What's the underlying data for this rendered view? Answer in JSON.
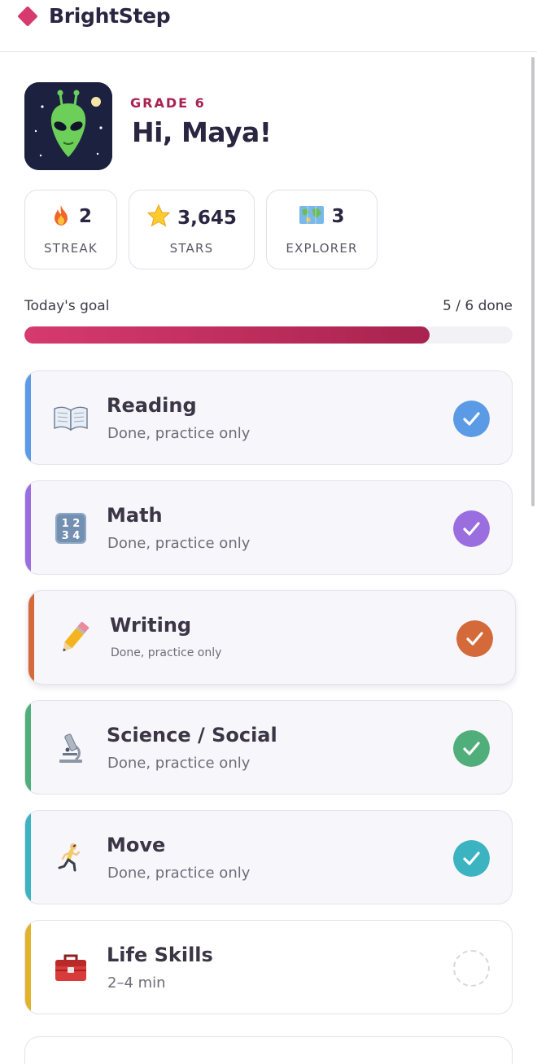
{
  "app": {
    "name": "BrightStep"
  },
  "profile": {
    "grade": "GRADE 6",
    "greeting": "Hi, Maya!"
  },
  "stats": [
    {
      "icon": "fire-icon",
      "value": "2",
      "label": "STREAK"
    },
    {
      "icon": "star-icon",
      "value": "3,645",
      "label": "STARS"
    },
    {
      "icon": "map-icon",
      "value": "3",
      "label": "EXPLORER"
    }
  ],
  "goal": {
    "label": "Today's goal",
    "value": "5 / 6 done",
    "progress": 0.83
  },
  "subjects": [
    {
      "title": "Reading",
      "status": "Done, practice only",
      "done": true,
      "icon": "book-icon",
      "color": "#5b9be6"
    },
    {
      "title": "Math",
      "status": "Done, practice only",
      "done": true,
      "icon": "numbers-icon",
      "color": "#9b6ee0"
    },
    {
      "title": "Writing",
      "status": "Done, practice only",
      "done": true,
      "icon": "pencil-icon",
      "color": "#d46a3a"
    },
    {
      "title": "Science / Social",
      "status": "Done, practice only",
      "done": true,
      "icon": "microscope-icon",
      "color": "#4fae79"
    },
    {
      "title": "Move",
      "status": "Done, practice only",
      "done": true,
      "icon": "runner-icon",
      "color": "#3bb3c0"
    },
    {
      "title": "Life Skills",
      "status": "2–4 min",
      "done": false,
      "icon": "toolbox-icon",
      "color": "#e2b32a"
    }
  ]
}
